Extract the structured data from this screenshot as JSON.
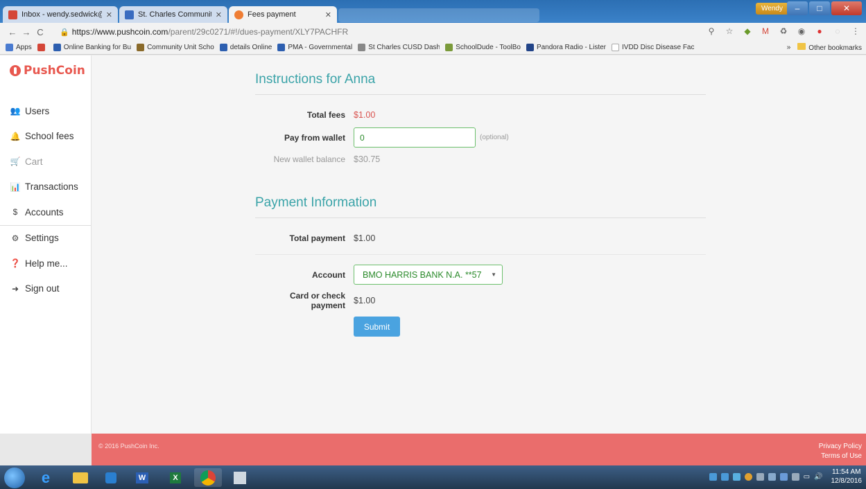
{
  "browser": {
    "tabs": [
      {
        "title": "Inbox - wendy.sedwick@",
        "favicon_color": "#d44638"
      },
      {
        "title": "St. Charles Community U",
        "favicon_color": "#3a6cc0"
      },
      {
        "title": "Fees payment",
        "favicon_color": "#ef7d33",
        "active": true
      }
    ],
    "user": "Wendy",
    "url_host": "https://www.pushcoin.com",
    "url_path": "/parent/29c0271/#!/dues-payment/XLY7PACHFR",
    "bookmarks": [
      {
        "label": "Apps",
        "color": "#4a7bd0"
      },
      {
        "label": "",
        "color": "#d44638"
      },
      {
        "label": "Online Banking for Bu",
        "color": "#2d5fb0"
      },
      {
        "label": "Community Unit Scho",
        "color": "#8a6a2a"
      },
      {
        "label": "details Online",
        "color": "#2d5fb0"
      },
      {
        "label": "PMA - Governmental",
        "color": "#2d5fb0"
      },
      {
        "label": "St Charles CUSD Dash",
        "color": "#888888"
      },
      {
        "label": "SchoolDude - ToolBo",
        "color": "#7a9a3a"
      },
      {
        "label": "Pandora Radio - Lister",
        "color": "#224488"
      },
      {
        "label": "IVDD Disc Disease Fac",
        "color": "#aaaaaa"
      }
    ],
    "more_bookmarks": "»",
    "other_bookmarks": "Other bookmarks"
  },
  "sidebar": {
    "logo": "PushCoin",
    "items": [
      {
        "label": "Users",
        "icon": "users-icon",
        "glyph": "👥"
      },
      {
        "label": "School fees",
        "icon": "bell-icon",
        "glyph": "🔔"
      },
      {
        "label": "Cart",
        "icon": "cart-icon",
        "glyph": "🛒"
      },
      {
        "label": "Transactions",
        "icon": "bar-chart-icon",
        "glyph": "📊"
      },
      {
        "label": "Accounts",
        "icon": "dollar-icon",
        "glyph": "$"
      },
      {
        "label": "Settings",
        "icon": "gear-icon",
        "glyph": "⚙"
      },
      {
        "label": "Help me...",
        "icon": "question-icon",
        "glyph": "❓"
      },
      {
        "label": "Sign out",
        "icon": "sign-out-icon",
        "glyph": "➜"
      }
    ]
  },
  "instructions": {
    "title": "Instructions for Anna",
    "total_fees_label": "Total fees",
    "total_fees_value": "$1.00",
    "wallet_label": "Pay from wallet",
    "wallet_value": "0",
    "wallet_hint": "(optional)",
    "new_balance_label": "New wallet balance",
    "new_balance_value": "$30.75"
  },
  "payment": {
    "title": "Payment Information",
    "total_payment_label": "Total payment",
    "total_payment_value": "$1.00",
    "account_label": "Account",
    "account_value": "BMO HARRIS BANK N.A. **57",
    "card_label": "Card or check payment",
    "card_value": "$1.00",
    "submit_label": "Submit"
  },
  "footer": {
    "copyright": "© 2016 PushCoin Inc.",
    "privacy": "Privacy Policy",
    "terms": "Terms of Use"
  },
  "taskbar": {
    "time": "11:54 AM",
    "date": "12/8/2016"
  },
  "colors": {
    "accent_teal": "#3aa3a8",
    "brand_red": "#e8584f",
    "footer": "#ea6d6c",
    "submit": "#4aa3e0"
  }
}
